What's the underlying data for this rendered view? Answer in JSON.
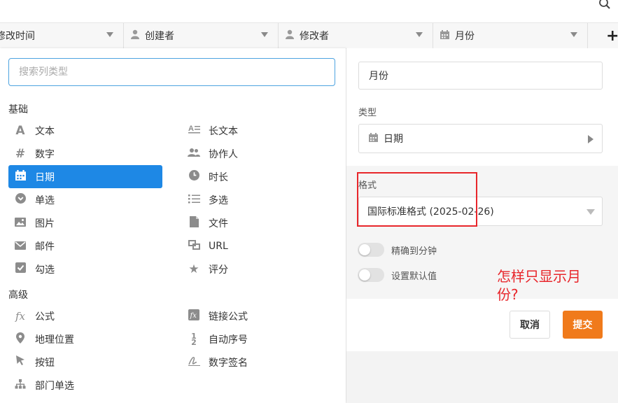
{
  "columns": [
    {
      "label": "修改时间",
      "icon": "clock-icon"
    },
    {
      "label": "创建者",
      "icon": "user-icon"
    },
    {
      "label": "修改者",
      "icon": "user-icon"
    },
    {
      "label": "月份",
      "icon": "calendar-icon"
    }
  ],
  "add_column": "+",
  "search": {
    "placeholder": "搜索列类型"
  },
  "sections": {
    "basic": "基础",
    "advanced": "高级"
  },
  "types": {
    "text": "文本",
    "long_text": "长文本",
    "number": "数字",
    "collaborator": "协作人",
    "date": "日期",
    "duration": "时长",
    "single_select": "单选",
    "multi_select": "多选",
    "image": "图片",
    "file": "文件",
    "email": "邮件",
    "url": "URL",
    "checkbox": "勾选",
    "rating": "评分",
    "formula": "公式",
    "link_formula": "链接公式",
    "geolocation": "地理位置",
    "auto_number": "自动序号",
    "button": "按钮",
    "digital_sign": "数字签名",
    "department": "部门单选"
  },
  "selected_type": "date",
  "settings": {
    "column_name": "月份",
    "type_label": "类型",
    "type_value": "日期",
    "format_label": "格式",
    "format_value": "国际标准格式 (2025-02-26)",
    "precise_minute": "精确到分钟",
    "default_value": "设置默认值",
    "cancel": "取消",
    "submit": "提交"
  },
  "annotation": "怎样只显示月份?",
  "colors": {
    "accent": "#1e88e5",
    "submit": "#f07a1b",
    "annotation": "#e8262b"
  }
}
